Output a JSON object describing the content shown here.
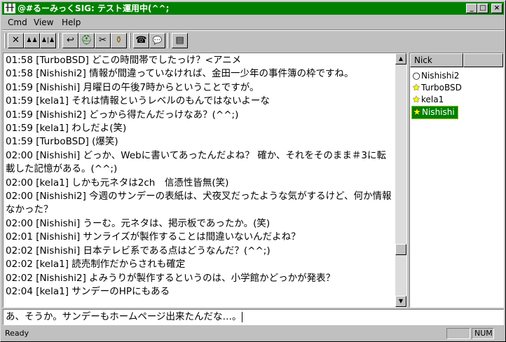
{
  "window": {
    "title": "@#るーみっくSIG: テスト運用中(^^;",
    "app_icon": "people-icon",
    "controls": [
      "_",
      "□",
      "×"
    ]
  },
  "menu": [
    "Cmd",
    "View",
    "Help"
  ],
  "toolbar": {
    "buttons": [
      "close-icon",
      "people-icon",
      "people-split-icon",
      "return-icon",
      "hat-icon",
      "tools-icon",
      "pot-icon",
      "user-card-icon",
      "chat-bubble-icon",
      "window-icon"
    ],
    "glyphs": [
      "✕",
      "♟♟",
      "♟|♟",
      "↩",
      "⛑",
      "✂",
      "⚱",
      "☎",
      "💬",
      "▤"
    ]
  },
  "chat": {
    "lines": [
      "01:58 [TurboBSD] どこの時間帯でしたっけ？<アニメ",
      "01:58 [Nishishi2] 情報が間違っていなければ、金田一少年の事件簿の枠ですね。",
      "01:59 [Nishishi] 月曜日の午後7時からということですが。",
      "01:59 [kela1] それは情報というレベルのもんではないよーな",
      "01:59 [Nishishi2] どっから得たんだっけなあ？(^^;)",
      "01:59 [kela1] わしだよ(笑)",
      "01:59 [TurboBSD] (爆笑)",
      "02:00 [Nishishi] どっか、Webに書いてあったんだよね？ 確か、それをそのまま＃3に転載した記憶がある。(^^;)",
      "02:00 [kela1] しかも元ネタは2ch　信憑性皆無(笑)",
      "02:00 [Nishishi2] 今週のサンデーの表紙は、犬夜叉だったような気がするけど、何か情報なかった？",
      "02:00 [Nishishi] うーむ。元ネタは、掲示板であったか。(笑)",
      "02:01 [Nishishi] サンライズが製作することは間違いないんだよね？",
      "02:02 [Nishishi] 日本テレビ系である点はどうなんだ？(^^;)",
      "02:02 [kela1] 読売制作だからされも確定",
      "02:02 [Nishishi2] よみうりが製作するというのは、小学館かどっかが発表？",
      "02:04 [kela1] サンデーのHPにもある"
    ]
  },
  "nicklist": {
    "header": "Nick",
    "items": [
      {
        "name": "Nishishi2",
        "mark": "○",
        "mark_color": "#000000"
      },
      {
        "name": "TurboBSD",
        "mark": "★",
        "mark_color": "#ffff00"
      },
      {
        "name": "kela1",
        "mark": "★",
        "mark_color": "#ffff00"
      },
      {
        "name": "Nishishi",
        "mark": "★",
        "mark_color": "#ffff00",
        "selected": true
      }
    ]
  },
  "input": {
    "value": "あ、そうか。サンデーもホームページ出来たんだな…。"
  },
  "status": {
    "text": "Ready",
    "num": "NUM"
  },
  "colors": {
    "titlebar": "#008000",
    "selection": "#008000",
    "face": "#c0c0c0"
  }
}
